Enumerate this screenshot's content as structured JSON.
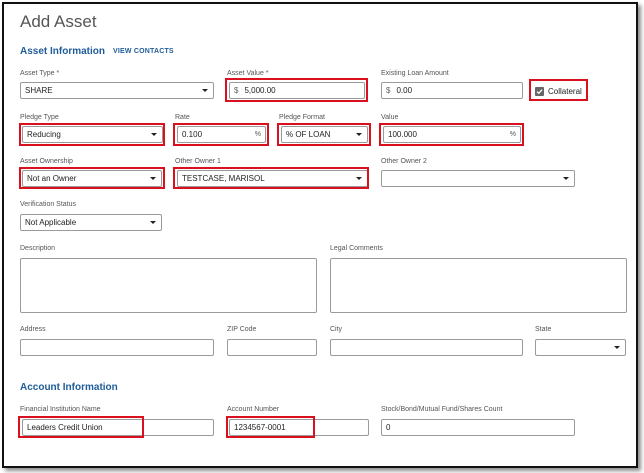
{
  "page": {
    "title": "Add Asset"
  },
  "asset_info": {
    "heading": "Asset Information",
    "view_contacts": "VIEW CONTACTS",
    "asset_type": {
      "label": "Asset Type *",
      "value": "SHARE"
    },
    "asset_value": {
      "label": "Asset Value *",
      "prefix": "$",
      "value": "5,000.00"
    },
    "existing_loan": {
      "label": "Existing Loan Amount",
      "prefix": "$",
      "value": "0.00"
    },
    "collateral": {
      "label": "Collateral",
      "checked": true
    },
    "pledge_type": {
      "label": "Pledge Type",
      "value": "Reducing"
    },
    "rate": {
      "label": "Rate",
      "value": "0.100",
      "suffix": "%"
    },
    "pledge_format": {
      "label": "Pledge Format",
      "value": "% OF LOAN"
    },
    "value": {
      "label": "Value",
      "value": "100.000",
      "suffix": "%"
    },
    "asset_ownership": {
      "label": "Asset Ownership",
      "value": "Not an Owner"
    },
    "other_owner_1": {
      "label": "Other Owner 1",
      "value": "TESTCASE, MARISOL"
    },
    "other_owner_2": {
      "label": "Other Owner 2",
      "value": ""
    },
    "verification_status": {
      "label": "Verification Status",
      "value": "Not Applicable"
    },
    "description": {
      "label": "Description",
      "value": ""
    },
    "legal_comments": {
      "label": "Legal Comments",
      "value": ""
    },
    "address": {
      "label": "Address",
      "value": ""
    },
    "zip": {
      "label": "ZIP Code",
      "value": ""
    },
    "city": {
      "label": "City",
      "value": ""
    },
    "state": {
      "label": "State",
      "value": ""
    }
  },
  "account_info": {
    "heading": "Account Information",
    "institution": {
      "label": "Financial Institution Name",
      "value": "Leaders Credit Union"
    },
    "account_number": {
      "label": "Account Number",
      "value": "1234567-0001"
    },
    "stock_count": {
      "label": "Stock/Bond/Mutual Fund/Shares Count",
      "value": "0"
    }
  },
  "colors": {
    "accent": "#1f5c99",
    "highlight": "#d9101e"
  },
  "icons": {
    "dropdown": "chevron-down-icon",
    "checkbox": "checkmark-icon"
  }
}
